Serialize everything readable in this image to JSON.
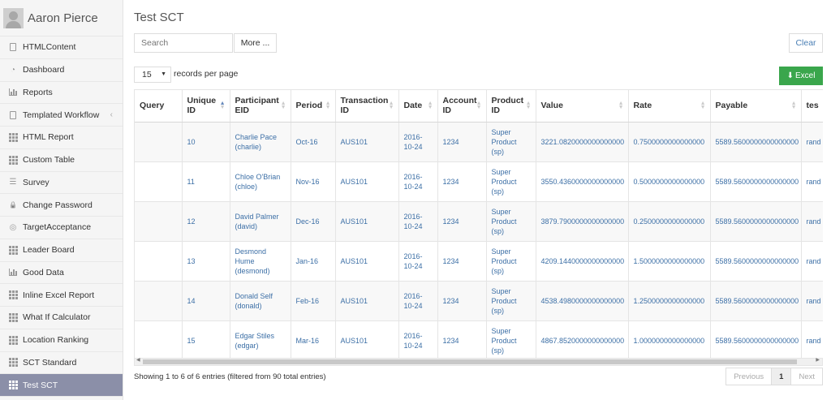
{
  "user": {
    "name": "Aaron Pierce"
  },
  "sidebar": {
    "items": [
      {
        "label": "HTMLContent",
        "icon": "document-icon",
        "active": false
      },
      {
        "label": "Dashboard",
        "icon": "dashboard-icon",
        "active": false
      },
      {
        "label": "Reports",
        "icon": "bar-chart-icon",
        "active": false
      },
      {
        "label": "Templated Workflow",
        "icon": "document-icon",
        "active": false,
        "caret": "‹"
      },
      {
        "label": "HTML Report",
        "icon": "table-icon",
        "active": false
      },
      {
        "label": "Custom Table",
        "icon": "table-icon",
        "active": false
      },
      {
        "label": "Survey",
        "icon": "list-icon",
        "active": false
      },
      {
        "label": "Change Password",
        "icon": "lock-icon",
        "active": false
      },
      {
        "label": "TargetAcceptance",
        "icon": "circle-icon",
        "active": false
      },
      {
        "label": "Leader Board",
        "icon": "table-icon",
        "active": false
      },
      {
        "label": "Good Data",
        "icon": "bar-chart-icon",
        "active": false
      },
      {
        "label": "Inline Excel Report",
        "icon": "table-icon",
        "active": false
      },
      {
        "label": "What If Calculator",
        "icon": "table-icon",
        "active": false
      },
      {
        "label": "Location Ranking",
        "icon": "table-icon",
        "active": false
      },
      {
        "label": "SCT Standard",
        "icon": "table-icon",
        "active": false
      },
      {
        "label": "Test SCT",
        "icon": "table-icon",
        "active": true
      }
    ]
  },
  "page": {
    "title": "Test SCT",
    "search_placeholder": "Search",
    "more_label": "More ...",
    "clear_label": "Clear",
    "page_length": "15",
    "page_length_label": "records per page",
    "excel_label": "Excel"
  },
  "table": {
    "columns": [
      "Query",
      "Unique ID",
      "Participant EID",
      "Period",
      "Transaction ID",
      "Date",
      "Account ID",
      "Product ID",
      "Value",
      "Rate",
      "Payable",
      "tes"
    ],
    "rows": [
      [
        "",
        "10",
        "Charlie Pace (charlie)",
        "Oct-16",
        "AUS101",
        "2016-10-24",
        "1234",
        "Super Product (sp)",
        "3221.0820000000000000",
        "0.7500000000000000",
        "5589.5600000000000000",
        "rand text"
      ],
      [
        "",
        "11",
        "Chloe O'Brian (chloe)",
        "Nov-16",
        "AUS101",
        "2016-10-24",
        "1234",
        "Super Product (sp)",
        "3550.4360000000000000",
        "0.5000000000000000",
        "5589.5600000000000000",
        "rand text"
      ],
      [
        "",
        "12",
        "David Palmer (david)",
        "Dec-16",
        "AUS101",
        "2016-10-24",
        "1234",
        "Super Product (sp)",
        "3879.7900000000000000",
        "0.2500000000000000",
        "5589.5600000000000000",
        "rand text"
      ],
      [
        "",
        "13",
        "Desmond Hume (desmond)",
        "Jan-16",
        "AUS101",
        "2016-10-24",
        "1234",
        "Super Product (sp)",
        "4209.1440000000000000",
        "1.5000000000000000",
        "5589.5600000000000000",
        "rand text"
      ],
      [
        "",
        "14",
        "Donald Self (donald)",
        "Feb-16",
        "AUS101",
        "2016-10-24",
        "1234",
        "Super Product (sp)",
        "4538.4980000000000000",
        "1.2500000000000000",
        "5589.5600000000000000",
        "rand text"
      ],
      [
        "",
        "15",
        "Edgar Stiles (edgar)",
        "Mar-16",
        "AUS101",
        "2016-10-24",
        "1234",
        "Super Product (sp)",
        "4867.8520000000000000",
        "1.0000000000000000",
        "5589.5600000000000000",
        "rand text"
      ]
    ]
  },
  "footer": {
    "info": "Showing 1 to 6 of 6 entries (filtered from 90 total entries)",
    "previous": "Previous",
    "current_page": "1",
    "next": "Next"
  },
  "colors": {
    "active_nav": "#8b8fa8",
    "excel": "#3aa64c",
    "link": "#3c6fa6"
  }
}
